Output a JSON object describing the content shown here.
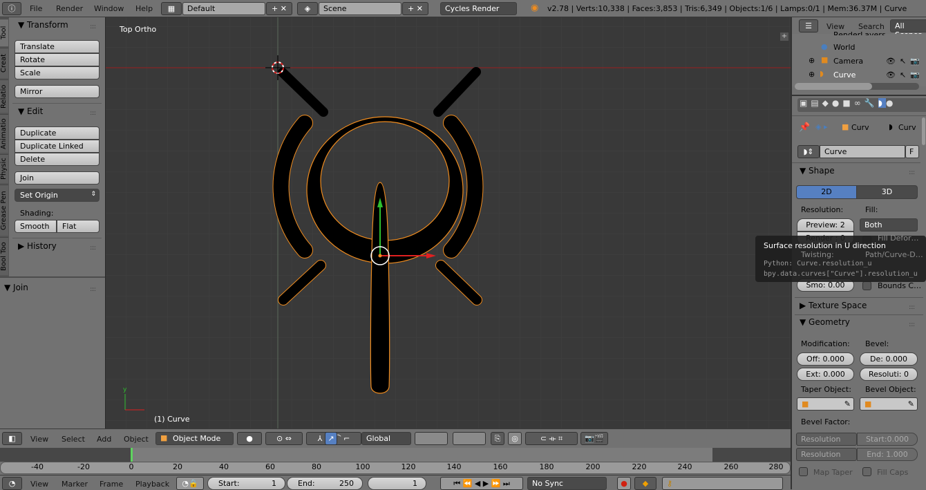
{
  "topbar": {
    "menus": [
      "File",
      "Render",
      "Window",
      "Help"
    ],
    "screen_layout": "Default",
    "scene": "Scene",
    "render_engine": "Cycles Render",
    "stats": "v2.78 | Verts:10,338 | Faces:3,853 | Tris:6,349 | Objects:1/6 | Lamps:0/1 | Mem:36.37M | Curve"
  },
  "tool_tabs": [
    "Tool",
    "Creat",
    "Relatio",
    "Animatio",
    "Physic",
    "Grease Pen",
    "Bool Too"
  ],
  "toolshelf": {
    "transform_title": "Transform",
    "transform_buttons": [
      "Translate",
      "Rotate",
      "Scale"
    ],
    "mirror": "Mirror",
    "edit_title": "Edit",
    "edit_buttons": [
      "Duplicate",
      "Duplicate Linked",
      "Delete"
    ],
    "join": "Join",
    "set_origin": "Set Origin",
    "shading_label": "Shading:",
    "smooth": "Smooth",
    "flat": "Flat",
    "history_title": "History",
    "operator_title": "Join"
  },
  "viewport": {
    "view_name": "Top Ortho",
    "object_label": "(1) Curve"
  },
  "view3d_header": {
    "menus": [
      "View",
      "Select",
      "Add",
      "Object"
    ],
    "mode": "Object Mode",
    "orientation": "Global"
  },
  "timeline": {
    "ticks": [
      "-40",
      "-20",
      "0",
      "20",
      "40",
      "60",
      "80",
      "100",
      "120",
      "140",
      "160",
      "180",
      "200",
      "220",
      "240",
      "260",
      "280"
    ],
    "menus": [
      "View",
      "Marker",
      "Frame",
      "Playback"
    ],
    "start_label": "Start:",
    "start": "1",
    "end_label": "End:",
    "end": "250",
    "current": "1",
    "sync": "No Sync",
    "current_frame_value": 0
  },
  "outliner": {
    "menus": [
      "View",
      "Search"
    ],
    "filter": "All Scenes",
    "items": [
      "RenderLayers",
      "World",
      "Camera",
      "Curve"
    ]
  },
  "properties": {
    "breadcrumb": [
      "Curv",
      "Curv"
    ],
    "datablock": "Curve",
    "fake_user": "F",
    "shape": {
      "title": "Shape",
      "mode_2d": "2D",
      "mode_3d": "3D",
      "mode_active": "2D",
      "resolution_label": "Resolution:",
      "preview": "Preview: 2",
      "render": "Render : 0",
      "fill_label": "Fill:",
      "fill": "Both",
      "fill_deform": "Fill Defor…",
      "twisting": "Twisting:",
      "path_deform": "Path/Curve-D…",
      "smooth": "Smo: 0.00",
      "bounds": "Bounds C…"
    },
    "texture_space": "Texture Space",
    "geometry": {
      "title": "Geometry",
      "modification": "Modification:",
      "offset": "Off: 0.000",
      "extrude": "Ext: 0.000",
      "bevel": "Bevel:",
      "depth": "De: 0.000",
      "resolution": "Resoluti: 0",
      "taper_object": "Taper Object:",
      "bevel_object": "Bevel Object:",
      "bevel_factor": "Bevel Factor:",
      "factor_mapping_start": "Resolution",
      "factor_mapping_end": "Resolution",
      "start": "Start:0.000",
      "end": "End:  1.000",
      "map_taper": "Map Taper",
      "fill_caps": "Fill Caps"
    }
  },
  "tooltip": {
    "title": "Surface resolution in U direction",
    "python1": "Python: Curve.resolution_u",
    "python2": "bpy.data.curves[\"Curve\"].resolution_u"
  },
  "colors": {
    "accent": "#5680c2",
    "x_axis": "#c02020",
    "y_axis": "#2a9a2a",
    "selection": "#f08c1e",
    "viewport_bg": "#393939"
  }
}
